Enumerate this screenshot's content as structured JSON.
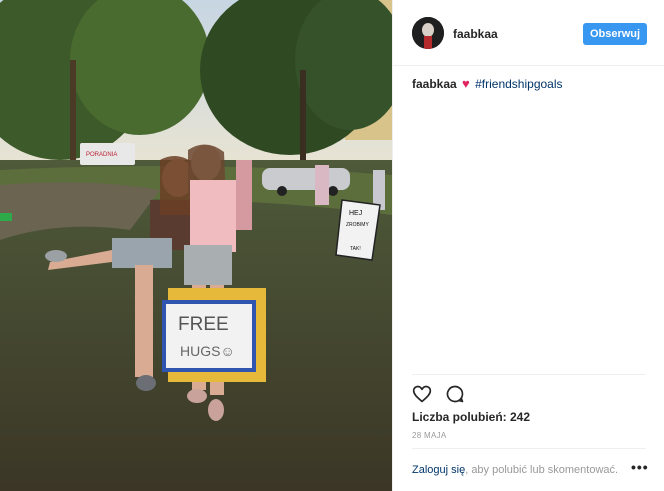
{
  "post": {
    "username": "faabkaa",
    "follow_label": "Obserwuj",
    "caption_user": "faabkaa",
    "caption_heart": "♥",
    "caption_hashtag": "#friendshipgoals",
    "likes_text": "Liczba polubień: 242",
    "date": "28 MAJA",
    "login_link": "Zaloguj się",
    "login_rest": ", aby polubić lub skomentować.",
    "more": "•••"
  },
  "photo": {
    "sign_text_line1": "FREE",
    "sign_text_line2": "HUGS☺",
    "board_text_line1": "HEJ",
    "board_text_line2": "ZROBIMY",
    "board_text_line3": "TAK!",
    "van_text": "PORADNIA"
  },
  "colors": {
    "accent": "#3897f0",
    "heart": "#e0245e",
    "link": "#003569"
  },
  "icons": [
    "heart-outline-icon",
    "comment-bubble-icon",
    "more-dots-icon"
  ]
}
